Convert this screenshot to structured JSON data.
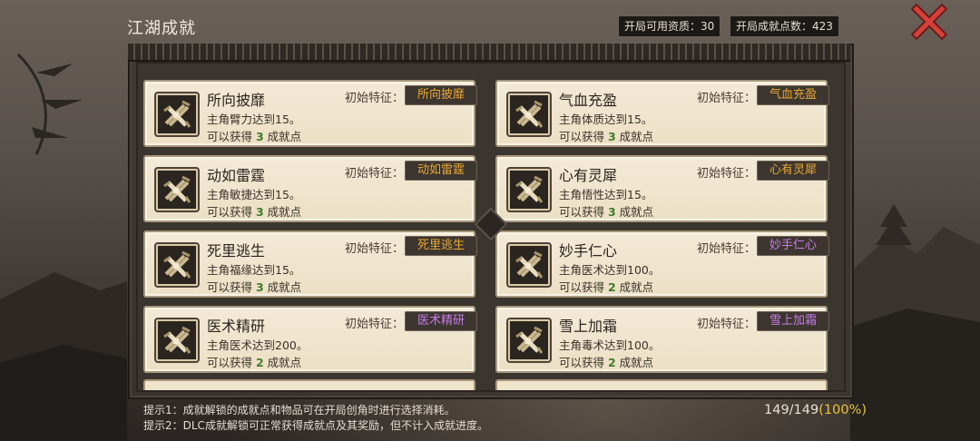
{
  "header": {
    "title": "江湖成就",
    "stat_talent_label": "开局可用资质：",
    "stat_talent_value": "30",
    "stat_points_label": "开局成就点数：",
    "stat_points_value": "423"
  },
  "achievements": [
    {
      "name": "所向披靡",
      "desc": "主角臂力达到15。",
      "reward_prefix": "可以获得 ",
      "points": "3",
      "reward_suffix": " 成就点",
      "trait_label": "初始特征：",
      "trait": "所向披靡",
      "trait_color": "#e8a834"
    },
    {
      "name": "气血充盈",
      "desc": "主角体质达到15。",
      "reward_prefix": "可以获得 ",
      "points": "3",
      "reward_suffix": " 成就点",
      "trait_label": "初始特征：",
      "trait": "气血充盈",
      "trait_color": "#e8a834"
    },
    {
      "name": "动如雷霆",
      "desc": "主角敏捷达到15。",
      "reward_prefix": "可以获得 ",
      "points": "3",
      "reward_suffix": " 成就点",
      "trait_label": "初始特征：",
      "trait": "动如雷霆",
      "trait_color": "#e8a834"
    },
    {
      "name": "心有灵犀",
      "desc": "主角悟性达到15。",
      "reward_prefix": "可以获得 ",
      "points": "3",
      "reward_suffix": " 成就点",
      "trait_label": "初始特征：",
      "trait": "心有灵犀",
      "trait_color": "#e8a834"
    },
    {
      "name": "死里逃生",
      "desc": "主角福缘达到15。",
      "reward_prefix": "可以获得 ",
      "points": "3",
      "reward_suffix": " 成就点",
      "trait_label": "初始特征：",
      "trait": "死里逃生",
      "trait_color": "#e8a834"
    },
    {
      "name": "妙手仁心",
      "desc": "主角医术达到100。",
      "reward_prefix": "可以获得 ",
      "points": "2",
      "reward_suffix": " 成就点",
      "trait_label": "初始特征：",
      "trait": "妙手仁心",
      "trait_color": "#c77be8"
    },
    {
      "name": "医术精研",
      "desc": "主角医术达到200。",
      "reward_prefix": "可以获得 ",
      "points": "2",
      "reward_suffix": " 成就点",
      "trait_label": "初始特征：",
      "trait": "医术精研",
      "trait_color": "#c77be8"
    },
    {
      "name": "雪上加霜",
      "desc": "主角毒术达到100。",
      "reward_prefix": "可以获得 ",
      "points": "2",
      "reward_suffix": " 成就点",
      "trait_label": "初始特征：",
      "trait": "雪上加霜",
      "trait_color": "#c77be8"
    }
  ],
  "icons": {
    "card_icon": "crossed-weapons-icon",
    "close": "close-x-icon"
  },
  "footer": {
    "hint1": "提示1：成就解锁的成就点和物品可在开局创角时进行选择消耗。",
    "hint2": "提示2：DLC成就解锁可正常获得成就点及其奖励，但不计入成就进度。",
    "progress_count": "149/149",
    "progress_pct": "(100%)"
  }
}
